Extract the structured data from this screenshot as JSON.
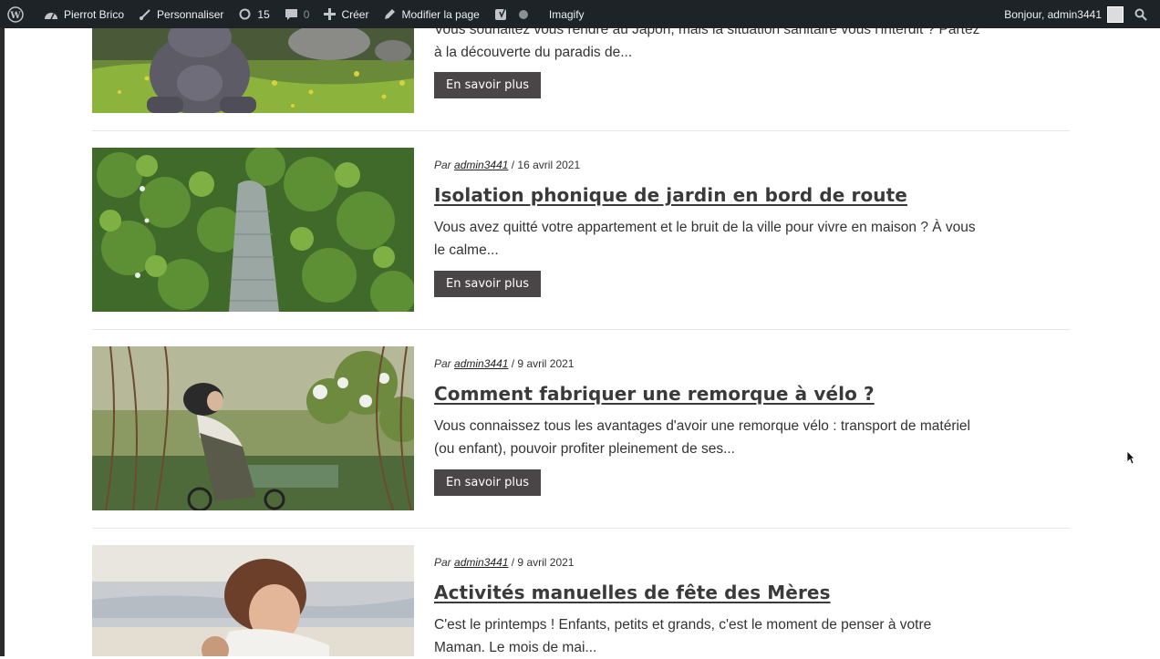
{
  "adminbar": {
    "site_name": "Pierrot Brico",
    "customize": "Personnaliser",
    "updates": "15",
    "comments": "0",
    "new": "Créer",
    "edit_page": "Modifier la page",
    "imagify": "Imagify",
    "greeting": "Bonjour, admin3441"
  },
  "posts": [
    {
      "excerpt": "Vous souhaitez vous rendre au Japon, mais la situation sanitaire vous l'interdit ? Partez à la  découverte du paradis de...",
      "button": "En savoir plus"
    },
    {
      "meta_prefix": "Par",
      "author": "admin3441",
      "date": "/ 16 avril 2021",
      "title": "Isolation phonique de jardin en bord de route",
      "excerpt": "Vous avez quitté votre appartement et le bruit de la ville pour vivre en maison ? À vous le calme...",
      "button": "En savoir plus"
    },
    {
      "meta_prefix": "Par",
      "author": "admin3441",
      "date": "/ 9 avril 2021",
      "title": "Comment fabriquer une remorque à vélo ?",
      "excerpt": "Vous connaissez tous les avantages d'avoir une remorque vélo : transport de matériel (ou enfant), pouvoir profiter pleinement de ses...",
      "button": "En savoir plus"
    },
    {
      "meta_prefix": "Par",
      "author": "admin3441",
      "date": "/ 9 avril 2021",
      "title": "Activités manuelles de fête des Mères",
      "excerpt": "C'est le printemps !   Enfants, petits et grands, c'est le moment de penser à votre Maman. Le mois de mai..."
    }
  ]
}
